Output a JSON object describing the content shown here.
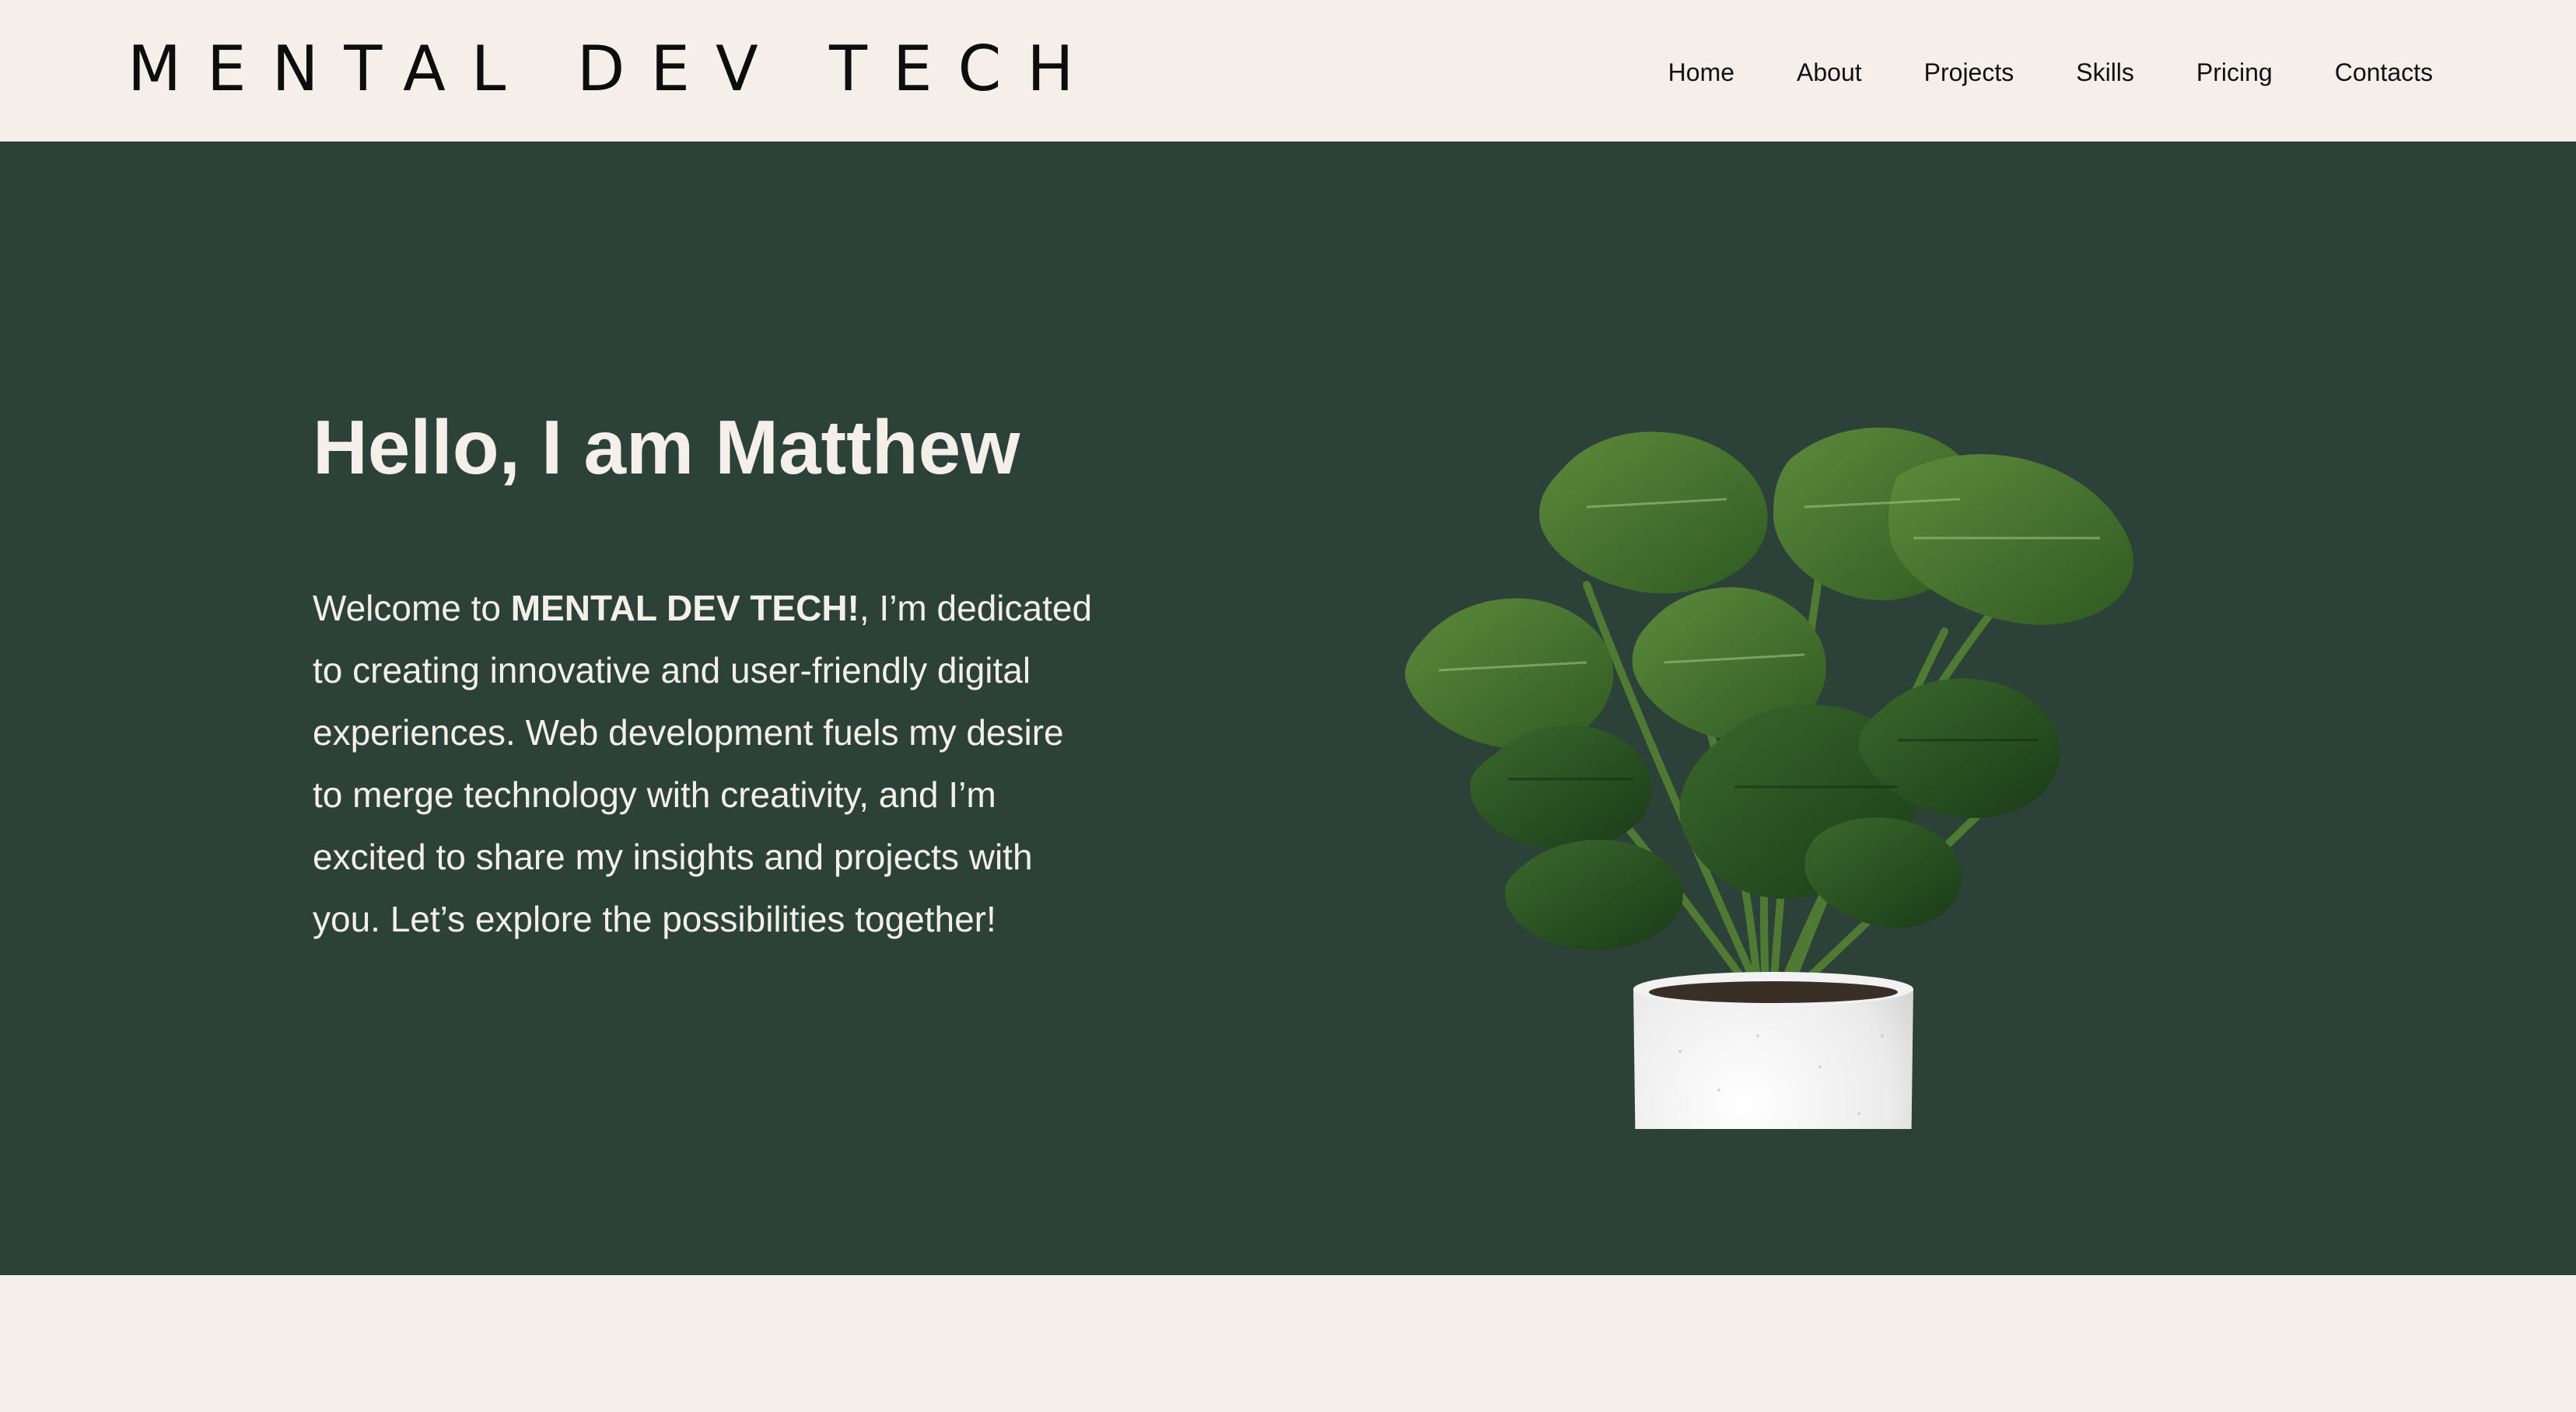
{
  "header": {
    "logo": "MENTAL DEV TECH",
    "nav": [
      "Home",
      "About",
      "Projects",
      "Skills",
      "Pricing",
      "Contacts"
    ]
  },
  "hero": {
    "title": "Hello, I am Matthew",
    "intro_prefix": "Welcome to ",
    "intro_brand": "MENTAL DEV TECH!",
    "intro_rest": ", I’m dedicated to creating innovative and user-friendly digital experiences. Web development fuels my desire to merge technology with creativity, and I’m excited to share my insights and projects with you. Let’s explore the possibilities together!"
  },
  "colors": {
    "header_bg": "#f4efe9",
    "hero_bg": "#2c4238",
    "hero_text": "#f4efe9",
    "nav_text": "#111111"
  },
  "icons": {
    "hero_image": "potted-monstera-plant"
  }
}
